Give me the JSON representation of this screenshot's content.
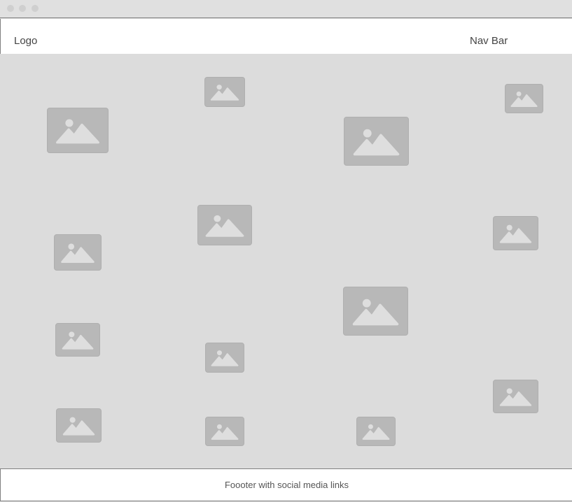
{
  "header": {
    "logo": "Logo",
    "nav": "Nav Bar"
  },
  "footer": {
    "text": "Foooter with social media links"
  },
  "icons": {
    "placeholder": "image-placeholder-icon"
  },
  "colors": {
    "background": "#dcdcdc",
    "placeholder": "#b8b8b8",
    "header": "#ffffff"
  }
}
